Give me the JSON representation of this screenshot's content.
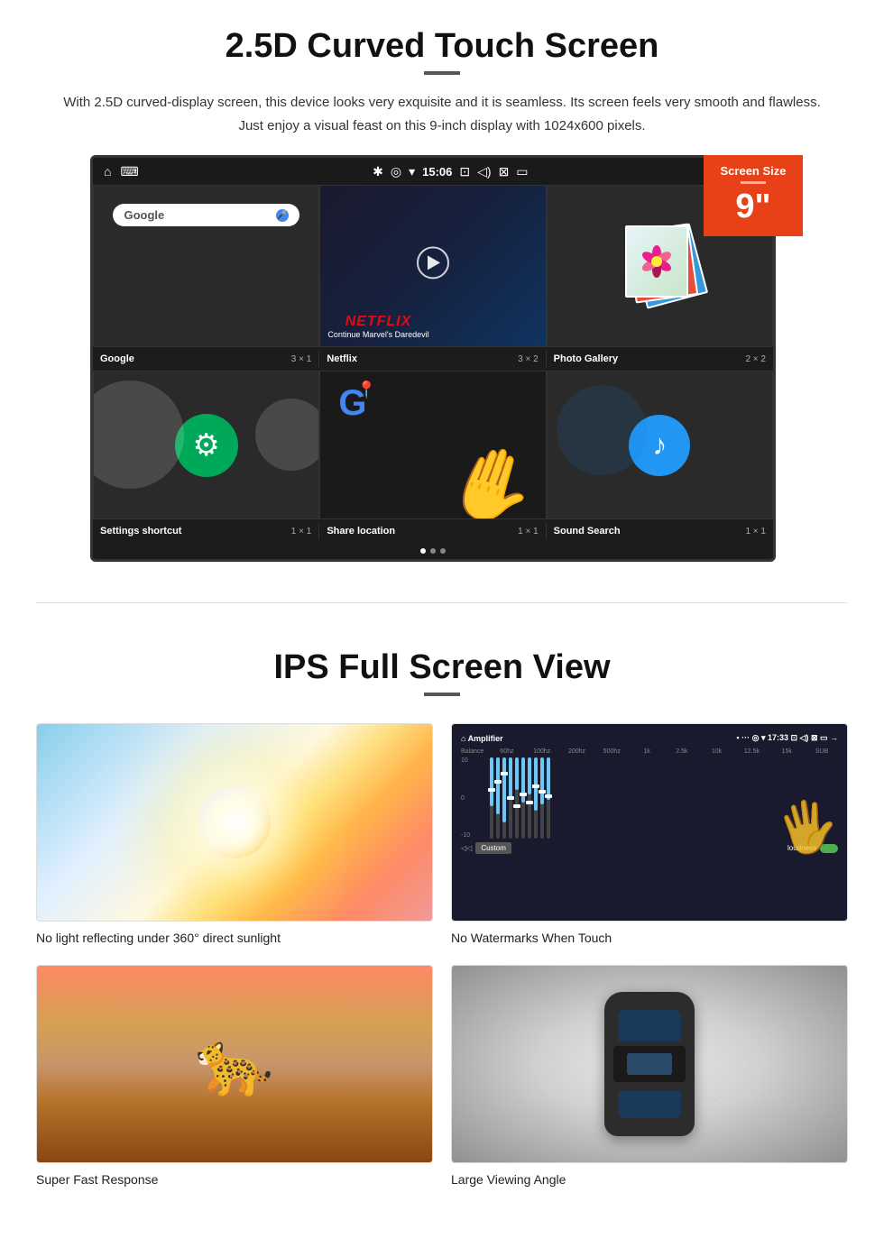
{
  "section1": {
    "title": "2.5D Curved Touch Screen",
    "description": "With 2.5D curved-display screen, this device looks very exquisite and it is seamless. Its screen feels very smooth and flawless. Just enjoy a visual feast on this 9-inch display with 1024x600 pixels.",
    "screen_badge": {
      "label": "Screen Size",
      "size": "9\""
    },
    "status_bar": {
      "time": "15:06"
    },
    "apps": [
      {
        "name": "Google",
        "grid": "3 × 1"
      },
      {
        "name": "Netflix",
        "grid": "3 × 2"
      },
      {
        "name": "Photo Gallery",
        "grid": "2 × 2"
      },
      {
        "name": "Settings shortcut",
        "grid": "1 × 1"
      },
      {
        "name": "Share location",
        "grid": "1 × 1"
      },
      {
        "name": "Sound Search",
        "grid": "1 × 1"
      }
    ],
    "netflix": {
      "logo": "NETFLIX",
      "subtitle": "Continue Marvel's Daredevil"
    }
  },
  "section2": {
    "title": "IPS Full Screen View",
    "features": [
      {
        "caption": "No light reflecting under 360° direct sunlight",
        "image_type": "sky"
      },
      {
        "caption": "No Watermarks When Touch",
        "image_type": "equalizer"
      },
      {
        "caption": "Super Fast Response",
        "image_type": "cheetah"
      },
      {
        "caption": "Large Viewing Angle",
        "image_type": "car"
      }
    ]
  }
}
